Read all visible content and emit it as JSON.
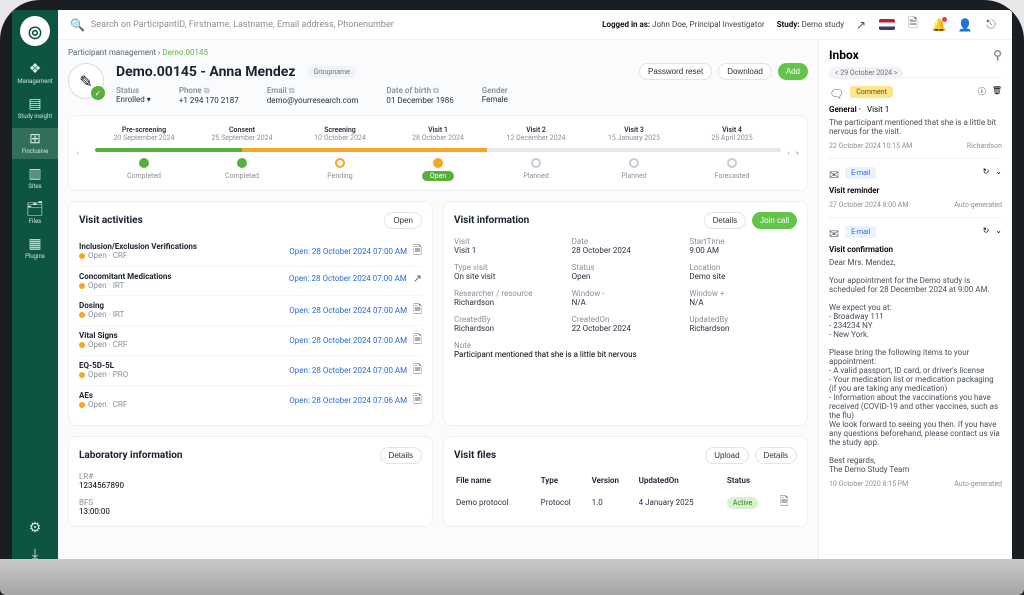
{
  "search": {
    "placeholder": "Search on ParticipantID, Firstname, Lastname, Email address, Phonenumber"
  },
  "header": {
    "logged_in_label": "Logged in as:",
    "logged_in_value": "John Doe, Principal Investigator",
    "study_label": "Study:",
    "study_value": "Demo study"
  },
  "sidebar": {
    "items": [
      {
        "icon": "❖",
        "label": "Management"
      },
      {
        "icon": "▤",
        "label": "Study insight"
      },
      {
        "icon": "⊞",
        "label": "Finclusive"
      },
      {
        "icon": "▥",
        "label": "Sites"
      },
      {
        "icon": "🗂",
        "label": "Files"
      },
      {
        "icon": "▦",
        "label": "Plugins"
      }
    ],
    "footer": [
      {
        "icon": "⚙"
      },
      {
        "icon": "⤓"
      }
    ]
  },
  "breadcrumb": {
    "parent": "Participant management",
    "current": "Demo.00145"
  },
  "patient": {
    "title": "Demo.00145 - Anna Mendez",
    "group": "Groupname",
    "actions": {
      "reset": "Password reset",
      "download": "Download",
      "add": "Add"
    },
    "fields": {
      "status": {
        "label": "Status",
        "value": "Enrolled"
      },
      "phone": {
        "label": "Phone",
        "value": "+1 294 170 2187"
      },
      "email": {
        "label": "Email",
        "value": "demo@yourresearch.com"
      },
      "dob": {
        "label": "Date of birth",
        "value": "01 December 1986"
      },
      "gender": {
        "label": "Gender",
        "value": "Female"
      }
    }
  },
  "timeline": {
    "steps": [
      {
        "title": "Pre-screening",
        "date": "20 September 2024",
        "status": "Completed"
      },
      {
        "title": "Consent",
        "date": "25 September 2024",
        "status": "Completed"
      },
      {
        "title": "Screening",
        "date": "10 October 2024",
        "status": "Pending"
      },
      {
        "title": "Visit 1",
        "date": "28 October 2024",
        "status": "Open"
      },
      {
        "title": "Visit 2",
        "date": "12 December 2024",
        "status": "Planned"
      },
      {
        "title": "Visit 3",
        "date": "15 January 2025",
        "status": "Planned"
      },
      {
        "title": "Visit 4",
        "date": "25 April 2025",
        "status": "Forecasted"
      }
    ]
  },
  "activities": {
    "title": "Visit activities",
    "open_btn": "Open",
    "items": [
      {
        "title": "Inclusion/Exclusion Verifications",
        "sub": "Open · CRF",
        "time": "Open: 28 October 2024  07:00 AM"
      },
      {
        "title": "Concomitant Medications",
        "sub": "Open · IRT",
        "time": "Open: 28 October 2024  07:00 AM"
      },
      {
        "title": "Dosing",
        "sub": "Open · IRT",
        "time": "Open: 28 October 2024  07:00 AM"
      },
      {
        "title": "Vital Signs",
        "sub": "Open · CRF",
        "time": "Open: 28 October 2024  07:00 AM"
      },
      {
        "title": "EQ-5D-5L",
        "sub": "Open · PRO",
        "time": "Open: 28 October 2024  07:00 AM"
      },
      {
        "title": "AEs",
        "sub": "Open · CRF",
        "time": "Open: 28 October 2024  07:06 AM"
      }
    ]
  },
  "visit_info": {
    "title": "Visit information",
    "details_btn": "Details",
    "join_btn": "Join call",
    "fields": [
      {
        "k": "Visit",
        "v": "Visit 1"
      },
      {
        "k": "Date",
        "v": "28 October 2024"
      },
      {
        "k": "StartTime",
        "v": "9:00 AM"
      },
      {
        "k": "Type visit",
        "v": "On site visit"
      },
      {
        "k": "Status",
        "v": "Open"
      },
      {
        "k": "Location",
        "v": "Demo site"
      },
      {
        "k": "Researcher / resource",
        "v": "Richardson"
      },
      {
        "k": "Window -",
        "v": "N/A"
      },
      {
        "k": "Window +",
        "v": "N/A"
      },
      {
        "k": "CreatedBy",
        "v": "Richardson"
      },
      {
        "k": "CreatedOn",
        "v": "22 October 2024"
      },
      {
        "k": "UpdatedBy",
        "v": "Richardson"
      }
    ],
    "note_label": "Note",
    "note": "Participant mentioned that she is a little bit nervous"
  },
  "lab": {
    "title": "Laboratory information",
    "details_btn": "Details",
    "lrn_label": "LR#",
    "lrn_value": "1234567890",
    "bfs_label": "BFS",
    "bfs_value": "13:00:00"
  },
  "files": {
    "title": "Visit files",
    "upload_btn": "Upload",
    "details_btn": "Details",
    "columns": [
      "File name",
      "Type",
      "Version",
      "UpdatedOn",
      "Status"
    ],
    "rows": [
      {
        "name": "Demo protocol",
        "type": "Protocol",
        "version": "1.0",
        "updated": "4 January 2025",
        "status": "Active"
      }
    ]
  },
  "inbox": {
    "title": "Inbox",
    "date": "< 29 October 2024 >",
    "items": [
      {
        "kind": "comment",
        "tag": "Comment",
        "head1": "General",
        "head2": "Visit 1",
        "body": "The participant mentioned that she is a little bit nervous for the visit.",
        "footer_l": "22 October 2024  10:15 AM",
        "footer_r": "Richardson"
      },
      {
        "kind": "email",
        "tag": "E-mail",
        "head1": "Visit reminder",
        "head2": "",
        "body": "",
        "footer_l": "27 October 2024  8:00 AM",
        "footer_r": "Auto-generated"
      },
      {
        "kind": "email",
        "tag": "E-mail",
        "head1": "Visit confirmation",
        "head2": "",
        "body": "Dear Mrs. Mendez,\n\nYour appointment for the Demo study is scheduled for 28 December 2024 at 9:00 AM.\n\nWe expect you at:\n- Broadway 111\n- 234234 NY\n- New York.\n\nPlease bring the following items to your appointment:\n- A valid passport, ID card, or driver's license\n- Your medication list or medication packaging (if you are taking any medication)\n- Information about the vaccinations you have received (COVID-19 and other vaccines, such as the flu)\nWe look forward to seeing you then. If you have any questions beforehand, please contact us via the study app.\n\nBest regards,\nThe Demo Study Team",
        "footer_l": "10 October 2020  8:15 PM",
        "footer_r": "Auto-generated"
      }
    ]
  }
}
